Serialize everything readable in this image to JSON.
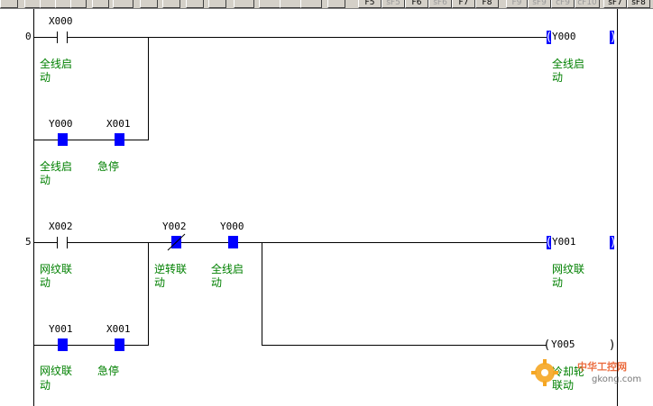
{
  "toolbar": {
    "function_keys": [
      {
        "label": "F5",
        "enabled": true
      },
      {
        "label": "sF5",
        "enabled": false
      },
      {
        "label": "F6",
        "enabled": true
      },
      {
        "label": "sF6",
        "enabled": false
      },
      {
        "label": "F7",
        "enabled": true
      },
      {
        "label": "F8",
        "enabled": true
      },
      {
        "label": "F9",
        "enabled": false
      },
      {
        "label": "sF9",
        "enabled": false
      },
      {
        "label": "cF9",
        "enabled": false
      },
      {
        "label": "cF10",
        "enabled": false
      },
      {
        "label": "sF7",
        "enabled": true
      },
      {
        "label": "sF8",
        "enabled": true
      }
    ]
  },
  "ladder": {
    "step_numbers": [
      "0",
      "5"
    ],
    "contacts": [
      {
        "address": "X000",
        "comment_l1": "全线启",
        "comment_l2": "动",
        "type": "no",
        "state": "off"
      },
      {
        "address": "Y000",
        "comment_l1": "全线启",
        "comment_l2": "动",
        "type": "no",
        "state": "on"
      },
      {
        "address": "X001",
        "comment_l1": "急停",
        "comment_l2": "",
        "type": "nc",
        "state": "on"
      },
      {
        "address": "X002",
        "comment_l1": "网纹联",
        "comment_l2": "动",
        "type": "no",
        "state": "off"
      },
      {
        "address": "Y002",
        "comment_l1": "逆转联",
        "comment_l2": "动",
        "type": "nc",
        "state": "on"
      },
      {
        "address": "Y000",
        "comment_l1": "全线启",
        "comment_l2": "动",
        "type": "no",
        "state": "on"
      },
      {
        "address": "Y001",
        "comment_l1": "网纹联",
        "comment_l2": "动",
        "type": "no",
        "state": "on"
      },
      {
        "address": "X001",
        "comment_l1": "急停",
        "comment_l2": "",
        "type": "nc",
        "state": "on"
      }
    ],
    "coils": [
      {
        "address": "Y000",
        "comment_l1": "全线启",
        "comment_l2": "动",
        "state": "on"
      },
      {
        "address": "Y001",
        "comment_l1": "网纹联",
        "comment_l2": "动",
        "state": "on"
      },
      {
        "address": "Y005",
        "comment_l1": "冷却轮",
        "comment_l2": "联动",
        "state": "off"
      }
    ]
  },
  "watermark": {
    "title": "中华工控网",
    "url": "gkong.com"
  },
  "colors": {
    "active": "#0000ff",
    "comment": "#008000",
    "wire": "#000000",
    "toolbar": "#d4d0c8"
  }
}
